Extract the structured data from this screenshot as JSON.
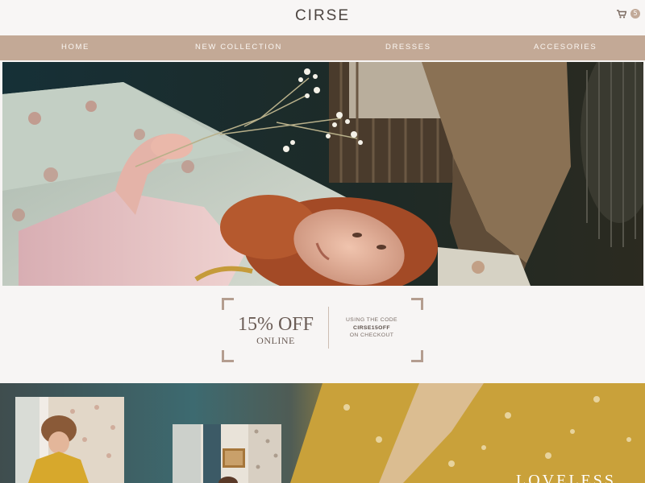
{
  "header": {
    "logo": "CIRSE",
    "cart_count": "5"
  },
  "nav": {
    "items": [
      {
        "label": "HOME"
      },
      {
        "label": "NEW COLLECTION"
      },
      {
        "label": "DRESSES"
      },
      {
        "label": "ACCESORIES"
      }
    ]
  },
  "promo": {
    "discount": "15% OFF",
    "channel": "ONLINE",
    "code_line_1": "USING THE CODE",
    "code": "CIRSE15OFF",
    "code_line_3": "ON CHECKOUT"
  },
  "collection": {
    "title": "LOVELESS"
  },
  "colors": {
    "nav_bar": "#c3a996",
    "accent_brackets": "#b49d8f",
    "background": "#f7f5f4"
  },
  "icons": {
    "cart": "shopping-cart-icon"
  }
}
